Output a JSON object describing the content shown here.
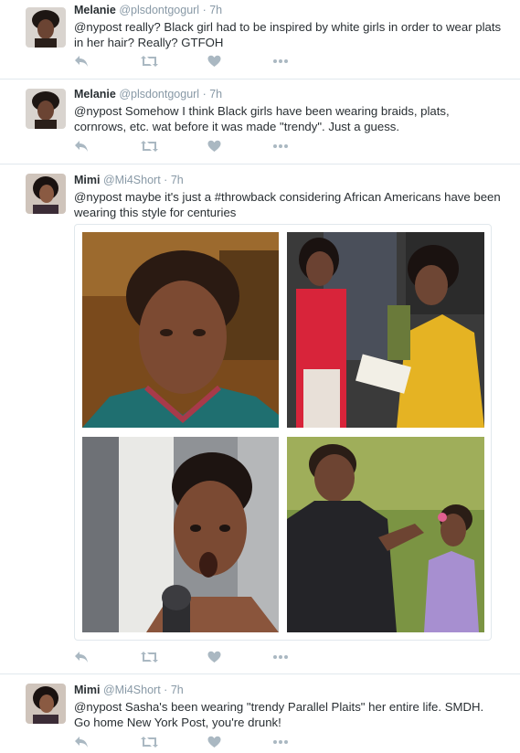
{
  "tweets": [
    {
      "fullname": "Melanie",
      "handle": "@plsdontgogurl",
      "separator": "·",
      "time": "7h",
      "text": "@nypost really? Black girl had to be inspired by white girls in order to wear plats in her hair? Really? GTFOH"
    },
    {
      "fullname": "Melanie",
      "handle": "@plsdontgogurl",
      "separator": "·",
      "time": "7h",
      "text": "@nypost Somehow I think Black girls have been wearing braids, plats, cornrows, etc. wat before it was made \"trendy\". Just a guess."
    },
    {
      "fullname": "Mimi",
      "handle": "@Mi4Short",
      "separator": "·",
      "time": "7h",
      "text": "@nypost maybe it's just a #throwback considering African Americans have been wearing this style for centuries"
    },
    {
      "fullname": "Mimi",
      "handle": "@Mi4Short",
      "separator": "·",
      "time": "7h",
      "text": "@nypost Sasha's been wearing \"trendy Parallel Plaits\" her entire life.  SMDH. Go home New York Post, you're drunk!"
    }
  ],
  "icons": {
    "reply": "reply-icon",
    "retweet": "retweet-icon",
    "like": "heart-icon",
    "more": "more-icon"
  },
  "colors": {
    "text": "#292f33",
    "muted": "#8899a6",
    "action_icon": "#aab8c2",
    "divider": "#e1e8ed"
  }
}
